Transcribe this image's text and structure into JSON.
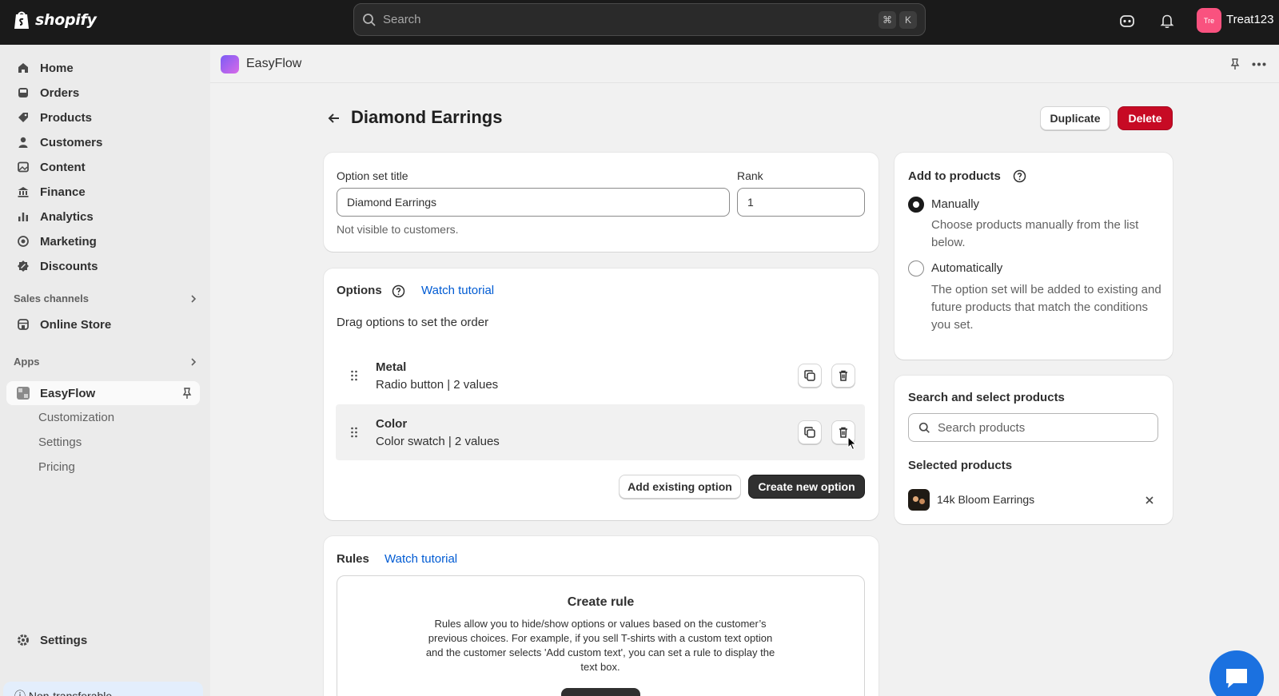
{
  "topbar": {
    "logo_text": "shopify",
    "search_placeholder": "Search",
    "shortcut_keys": [
      "⌘",
      "K"
    ],
    "avatar_initials": "Tre",
    "store_name": "Treat123",
    "icons": [
      "assistant-icon",
      "bell-icon"
    ]
  },
  "sidebar": {
    "items": [
      {
        "label": "Home",
        "icon": "home-icon"
      },
      {
        "label": "Orders",
        "icon": "inbox-icon"
      },
      {
        "label": "Products",
        "icon": "tag-icon"
      },
      {
        "label": "Customers",
        "icon": "person-icon"
      },
      {
        "label": "Content",
        "icon": "image-icon"
      },
      {
        "label": "Finance",
        "icon": "bank-icon"
      },
      {
        "label": "Analytics",
        "icon": "bar-chart-icon"
      },
      {
        "label": "Marketing",
        "icon": "target-icon"
      },
      {
        "label": "Discounts",
        "icon": "discount-icon"
      }
    ],
    "sales_channels_label": "Sales channels",
    "online_store_label": "Online Store",
    "apps_label": "Apps",
    "app_item_label": "EasyFlow",
    "app_subitems": [
      "Customization",
      "Settings",
      "Pricing"
    ],
    "settings_label": "Settings",
    "footer_text": "Non-transferable"
  },
  "app_header": {
    "name": "EasyFlow"
  },
  "page": {
    "title": "Diamond Earrings",
    "duplicate_label": "Duplicate",
    "delete_label": "Delete"
  },
  "option_set": {
    "title_label": "Option set title",
    "title_value": "Diamond Earrings",
    "rank_label": "Rank",
    "rank_value": "1",
    "help_text": "Not visible to customers."
  },
  "options": {
    "heading": "Options",
    "tutorial_link": "Watch tutorial",
    "hint": "Drag options to set the order",
    "items": [
      {
        "name": "Metal",
        "desc": "Radio button | 2 values"
      },
      {
        "name": "Color",
        "desc": "Color swatch | 2 values"
      }
    ],
    "add_existing_label": "Add existing option",
    "create_new_label": "Create new option"
  },
  "rules": {
    "heading": "Rules",
    "tutorial_link": "Watch tutorial",
    "box_title": "Create rule",
    "box_text": "Rules allow you to hide/show options or values based on the customer’s previous choices. For example, if you sell T-shirts with a custom text option and the customer selects 'Add custom text', you can set a rule to display the text box."
  },
  "add_to_products": {
    "heading": "Add to products",
    "selected_mode": "Manually",
    "manual_label": "Manually",
    "manual_desc": "Choose products manually from the list below.",
    "auto_label": "Automatically",
    "auto_desc": "The option set will be added to existing and future products that match the conditions you set."
  },
  "product_search": {
    "heading": "Search and select products",
    "placeholder": "Search products",
    "selected_heading": "Selected products",
    "selected": [
      {
        "name": "14k Bloom Earrings"
      }
    ]
  },
  "colors": {
    "topbar": "#1a1a1a",
    "danger": "#c70a24",
    "link": "#005bd3",
    "primary_button": "#303030",
    "chat": "#1b71e0"
  }
}
